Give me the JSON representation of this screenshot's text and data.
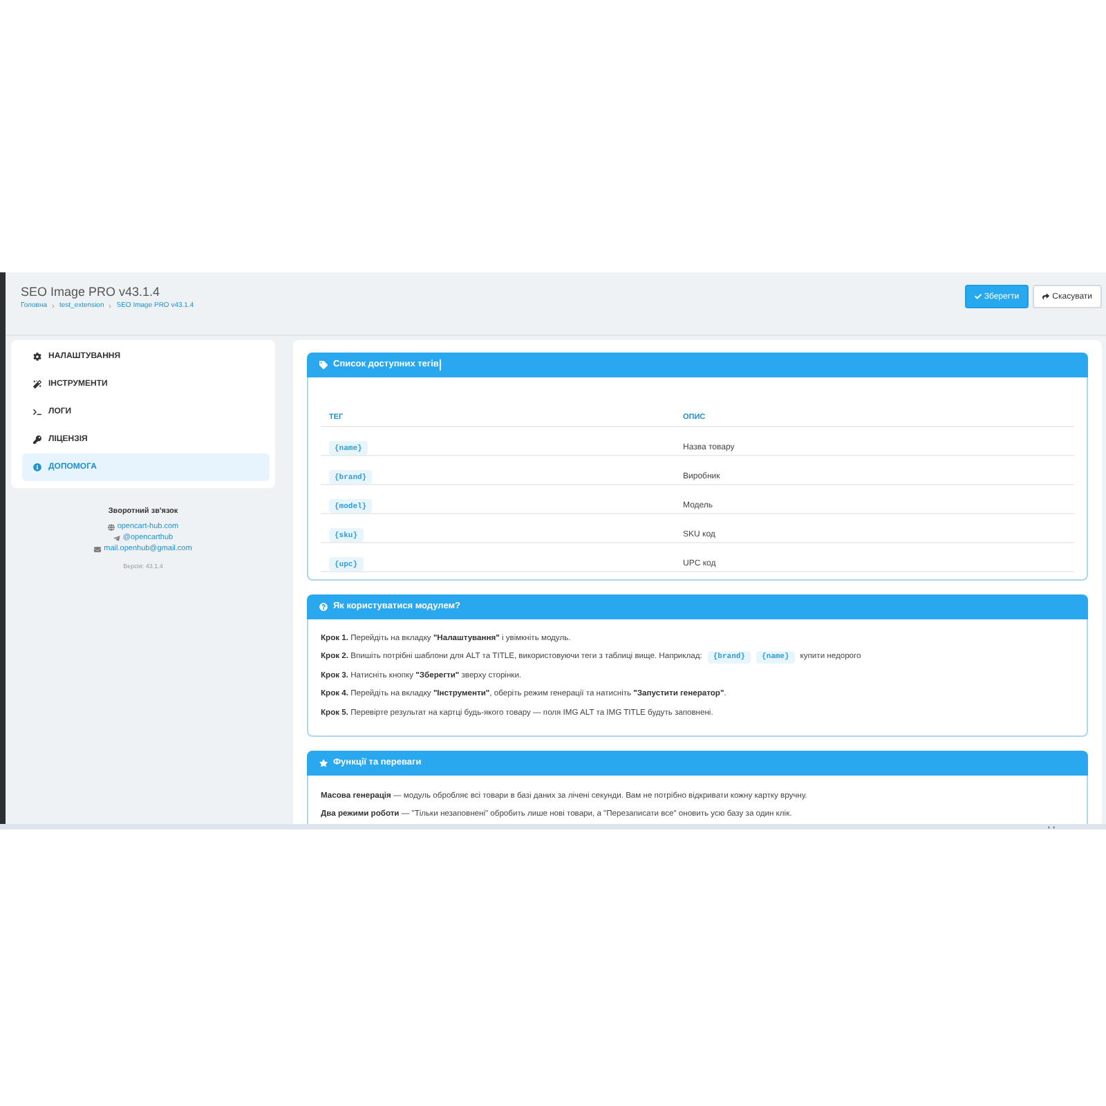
{
  "header": {
    "title": "SEO Image PRO v43.1.4",
    "breadcrumbs": [
      "Головна",
      "test_extension",
      "SEO Image PRO v43.1.4"
    ],
    "buttons": [
      {
        "kind": "primary",
        "label": "Зберегти"
      },
      {
        "kind": "default",
        "label": "Скасувати"
      }
    ]
  },
  "sidebar": {
    "items": [
      {
        "label": "НАЛАШТУВАННЯ",
        "selected": false
      },
      {
        "label": "ІНСТРУМЕНТИ",
        "selected": false
      },
      {
        "label": "ЛОГИ",
        "selected": false
      },
      {
        "label": "ЛІЦЕНЗІЯ",
        "selected": false
      },
      {
        "label": "ДОПОМОГА",
        "selected": true
      }
    ],
    "contact": {
      "title": "Зворотний зв'язок",
      "links": [
        "opencart-hub.com",
        "@opencarthub",
        "mail.openhub@gmail.com"
      ],
      "version": "Версія: 43.1.4"
    }
  },
  "panels": [
    {
      "kind": "table",
      "title": "Список доступних тегів",
      "columns": [
        "ТЕГ",
        "ОПИС"
      ],
      "rows": [
        {
          "tag": "{name}",
          "description": "Назва товару"
        },
        {
          "tag": "{brand}",
          "description": "Виробник"
        },
        {
          "tag": "{model}",
          "description": "Модель"
        },
        {
          "tag": "{sku}",
          "description": "SKU код"
        },
        {
          "tag": "{upc}",
          "description": "UPC код"
        }
      ]
    },
    {
      "kind": "steps",
      "title": "Як користуватися модулем?",
      "lines": [
        {
          "parts": [
            {
              "kind": "text",
              "text": "**Крок 1.** Перейдіть на вкладку **\"Налаштування\"** і увімкніть модуль."
            }
          ]
        },
        {
          "parts": [
            {
              "kind": "text",
              "text": "**Крок 2.** Впишіть потрібні шаблони для ALT та TITLE, використовуючи теги з таблиці вище. Наприклад:"
            },
            {
              "kind": "code",
              "text": "{brand}"
            },
            {
              "kind": "code",
              "text": "{name}"
            },
            {
              "kind": "text",
              "text": "купити недорого"
            }
          ]
        },
        {
          "parts": [
            {
              "kind": "text",
              "text": "**Крок 3.** Натисніть кнопку **\"Зберегти\"** зверху сторінки."
            }
          ]
        },
        {
          "parts": [
            {
              "kind": "text",
              "text": "**Крок 4.** Перейдіть на вкладку **\"Інструменти\"**, оберіть режим генерації та натисніть **\"Запустити генератор\"**."
            }
          ]
        },
        {
          "parts": [
            {
              "kind": "text",
              "text": "**Крок 5.** Перевірте результат на картці будь-якого товару — поля IMG ALT та IMG TITLE будуть заповнені."
            }
          ]
        }
      ]
    },
    {
      "kind": "features",
      "title": "Функції та переваги",
      "lines": [
        {
          "parts": [
            {
              "kind": "text",
              "text": "**Масова генерація** — модуль обробляє всі товари в базі даних за лічені секунди. Вам не потрібно відкривати кожну картку вручну."
            }
          ]
        },
        {
          "parts": [
            {
              "kind": "text",
              "text": "**Два режими роботи** — \"Тільки незаповнені\" обробить лише нові товари, а \"Перезаписати все\" оновить усю базу за один клік."
            }
          ]
        }
      ]
    }
  ]
}
